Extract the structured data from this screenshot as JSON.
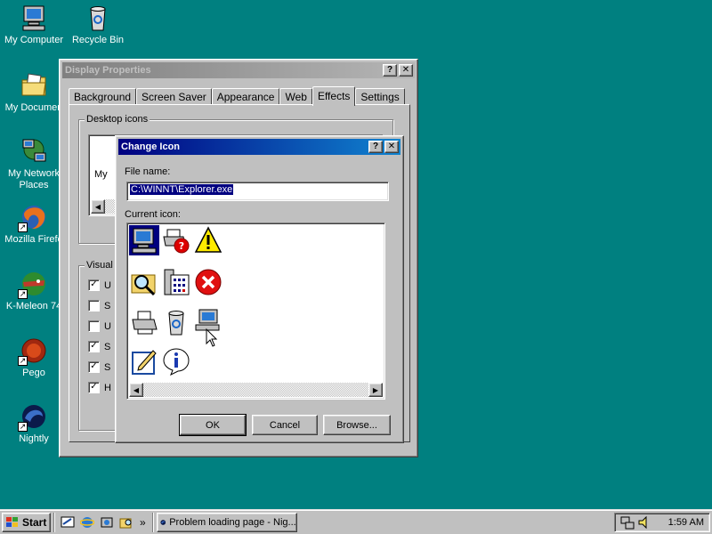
{
  "desktop": {
    "background": "#008080",
    "icons": [
      {
        "label": "My Computer",
        "icon": "computer-icon"
      },
      {
        "label": "Recycle Bin",
        "icon": "recycle-bin-icon"
      },
      {
        "label": "My Documen",
        "icon": "folder-icon"
      },
      {
        "label": "My Network",
        "label2": "Places",
        "icon": "network-icon"
      },
      {
        "label": "Mozilla Firefo",
        "icon": "firefox-icon"
      },
      {
        "label": "K-Meleon 74",
        "icon": "kmeleon-icon"
      },
      {
        "label": "Pego",
        "icon": "pego-icon"
      },
      {
        "label": "Nightly",
        "icon": "nightly-icon"
      }
    ]
  },
  "display_properties": {
    "title": "Display Properties",
    "help_button": "?",
    "close_button": "✕",
    "tabs": [
      "Background",
      "Screen Saver",
      "Appearance",
      "Web",
      "Effects",
      "Settings"
    ],
    "selected_tab": "Effects",
    "desktop_icons_group": "Desktop icons",
    "icon_list_partial": "My",
    "visual_group": "Visual",
    "checkboxes": [
      {
        "label": "U",
        "checked": true
      },
      {
        "label": "S",
        "checked": false
      },
      {
        "label": "U",
        "checked": false
      },
      {
        "label": "S",
        "checked": true
      },
      {
        "label": "S",
        "checked": true
      },
      {
        "label": "H",
        "checked": true
      }
    ]
  },
  "change_icon": {
    "title": "Change Icon",
    "help_button": "?",
    "close_button": "✕",
    "file_name_label": "File name:",
    "file_name_value": "C:\\WINNT\\Explorer.exe",
    "current_icon_label": "Current icon:",
    "icons": [
      "computer-icon",
      "printer-question-icon",
      "warning-icon",
      "search-icon",
      "calculator-icon",
      "error-icon",
      "printer-icon",
      "recycle-bin-icon",
      "network-computer-icon",
      "notepad-icon",
      "info-icon"
    ],
    "selected_icon_index": 0,
    "ok_label": "OK",
    "cancel_label": "Cancel",
    "browse_label": "Browse..."
  },
  "taskbar": {
    "start_label": "Start",
    "quick_launch": [
      "desktop-icon",
      "ie-icon",
      "channels-icon",
      "explorer-icon"
    ],
    "overflow": "»",
    "tasks": [
      {
        "label": "Problem loading page - Nig..."
      }
    ],
    "clock": "1:59 AM"
  }
}
